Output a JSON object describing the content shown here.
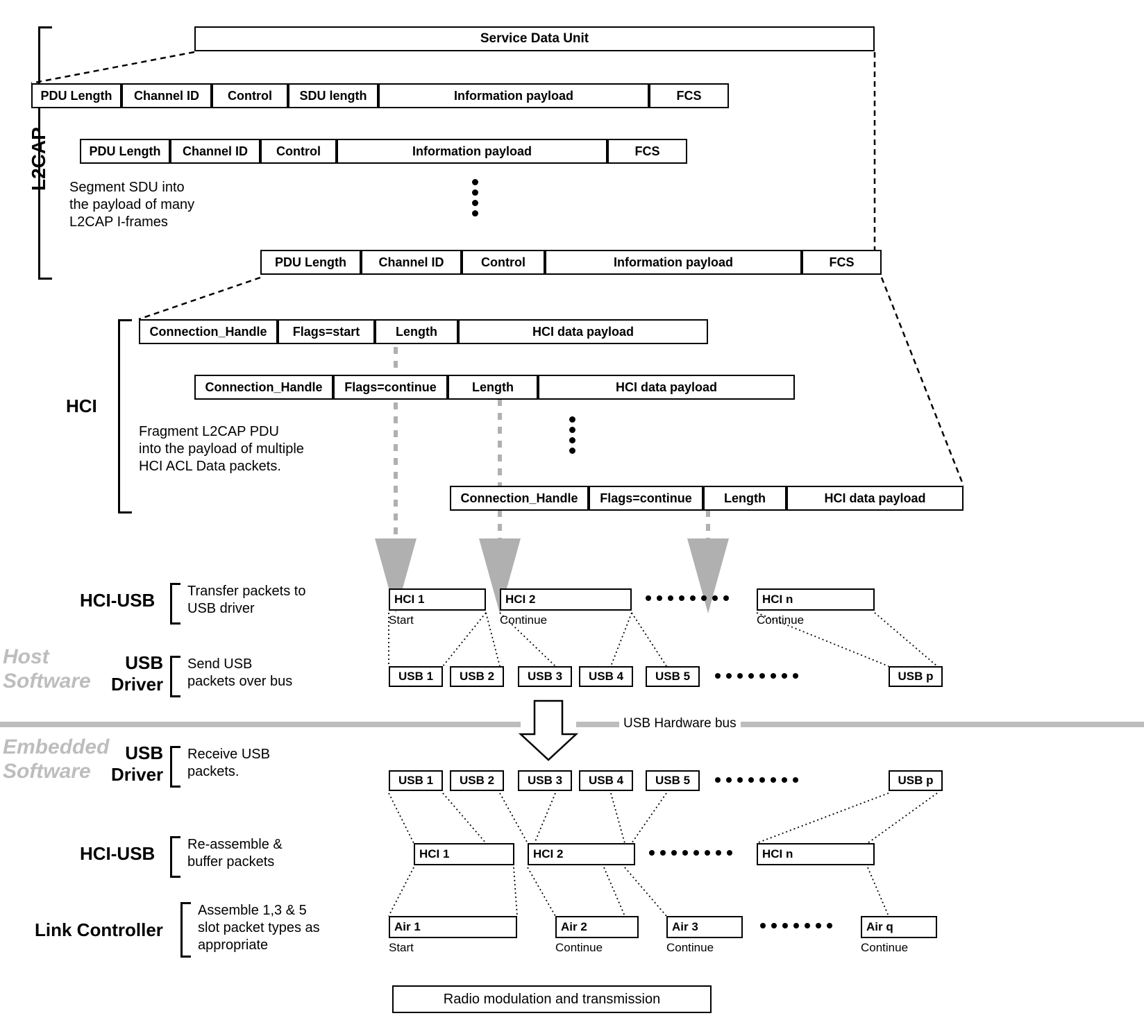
{
  "sdu": {
    "label": "Service Data Unit"
  },
  "l2cap": {
    "title": "L2CAP",
    "desc": "Segment SDU into\nthe payload of many\nL2CAP I-frames",
    "row1": {
      "pdu_length": "PDU Length",
      "channel_id": "Channel ID",
      "control": "Control",
      "sdu_length": "SDU length",
      "info_payload": "Information payload",
      "fcs": "FCS"
    },
    "row2": {
      "pdu_length": "PDU Length",
      "channel_id": "Channel ID",
      "control": "Control",
      "info_payload": "Information payload",
      "fcs": "FCS"
    },
    "row3": {
      "pdu_length": "PDU Length",
      "channel_id": "Channel ID",
      "control": "Control",
      "info_payload": "Information payload",
      "fcs": "FCS"
    }
  },
  "hci": {
    "title": "HCI",
    "desc": "Fragment L2CAP PDU\ninto the payload of multiple\nHCI ACL Data packets.",
    "row1": {
      "conn_handle": "Connection_Handle",
      "flags": "Flags=start",
      "length": "Length",
      "payload": "HCI data payload"
    },
    "row2": {
      "conn_handle": "Connection_Handle",
      "flags": "Flags=continue",
      "length": "Length",
      "payload": "HCI data payload"
    },
    "row3": {
      "conn_handle": "Connection_Handle",
      "flags": "Flags=continue",
      "length": "Length",
      "payload": "HCI data payload"
    }
  },
  "host_label": "Host\nSoftware",
  "embedded_label": "Embedded\nSoftware",
  "hci_usb_host": {
    "title": "HCI-USB",
    "desc": "Transfer packets to\nUSB driver",
    "pkts": {
      "p1": "HCI 1",
      "p2": "HCI 2",
      "pn": "HCI n"
    },
    "subs": {
      "s1": "Start",
      "s2": "Continue",
      "sn": "Continue"
    }
  },
  "usb_driver_host": {
    "title": "USB\nDriver",
    "desc": "Send USB\npackets over bus",
    "pkts": {
      "u1": "USB 1",
      "u2": "USB 2",
      "u3": "USB 3",
      "u4": "USB 4",
      "u5": "USB 5",
      "up": "USB p"
    }
  },
  "usb_bus_label": "USB Hardware bus",
  "usb_driver_emb": {
    "title": "USB\nDriver",
    "desc": "Receive USB\npackets.",
    "pkts": {
      "u1": "USB 1",
      "u2": "USB 2",
      "u3": "USB 3",
      "u4": "USB 4",
      "u5": "USB 5",
      "up": "USB p"
    }
  },
  "hci_usb_emb": {
    "title": "HCI-USB",
    "desc": "Re-assemble &\nbuffer packets",
    "pkts": {
      "p1": "HCI 1",
      "p2": "HCI 2",
      "pn": "HCI n"
    }
  },
  "link_ctrl": {
    "title": "Link Controller",
    "desc": "Assemble 1,3 & 5\nslot packet types as\nappropriate",
    "pkts": {
      "a1": "Air 1",
      "a2": "Air 2",
      "a3": "Air 3",
      "aq": "Air q"
    },
    "subs": {
      "s1": "Start",
      "s2": "Continue",
      "s3": "Continue",
      "sq": "Continue"
    }
  },
  "radio": {
    "label": "Radio modulation and transmission"
  }
}
